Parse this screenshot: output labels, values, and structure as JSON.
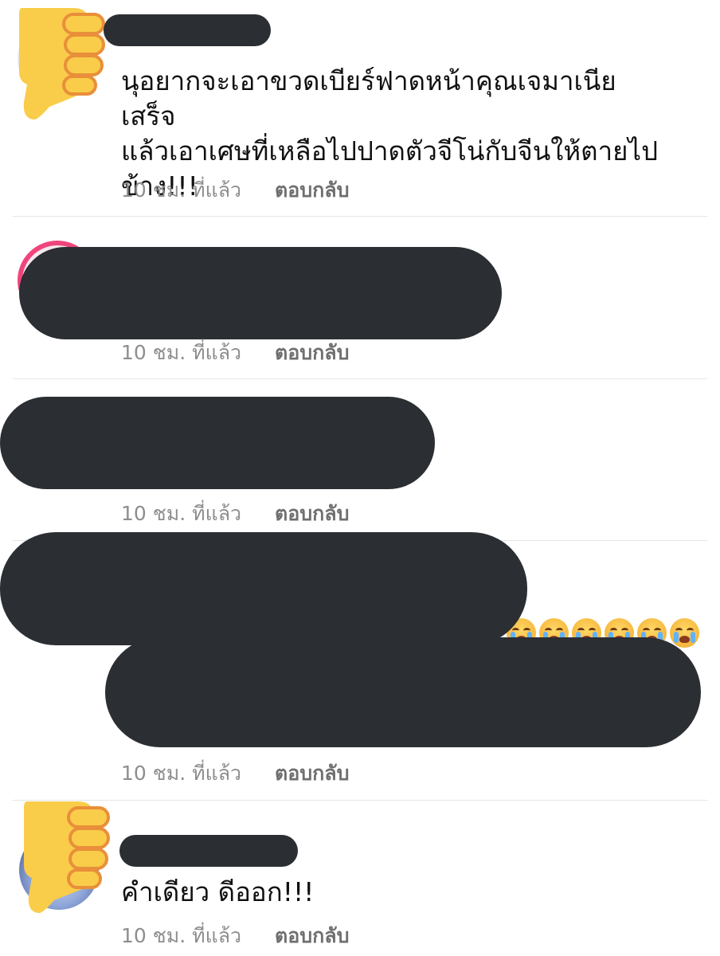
{
  "comments": [
    {
      "text": "นุอยากจะเอาขวดเบียร์ฟาดหน้าคุณเจมาเนีย เสร็จ\nแล้วเอาเศษที่เหลือไปปาดตัวจีโน่กับจีนให้ตายไป\nข้าง!!!",
      "time": "10 ชม. ที่แล้ว",
      "reply": "ตอบกลับ"
    },
    {
      "time": "10 ชม. ที่แล้ว",
      "reply": "ตอบกลับ"
    },
    {
      "time": "10 ชม. ที่แล้ว",
      "reply": "ตอบกลับ"
    },
    {
      "time": "10 ชม. ที่แล้ว",
      "reply": "ตอบกลับ"
    },
    {
      "text": "คำเดียว ดีออก!!!",
      "time": "10 ชม. ที่แล้ว",
      "reply": "ตอบกลับ"
    }
  ],
  "icons": {
    "thumb": "thumbs-down-icon",
    "emoji": "loudly-crying-face-icon"
  },
  "colors": {
    "redaction": "#2b2e33",
    "thumb": "#f9cd4a",
    "thumb_outline": "#e98f3a",
    "meta_text": "#8e8e8e",
    "reply_text": "#6f6f6f"
  }
}
